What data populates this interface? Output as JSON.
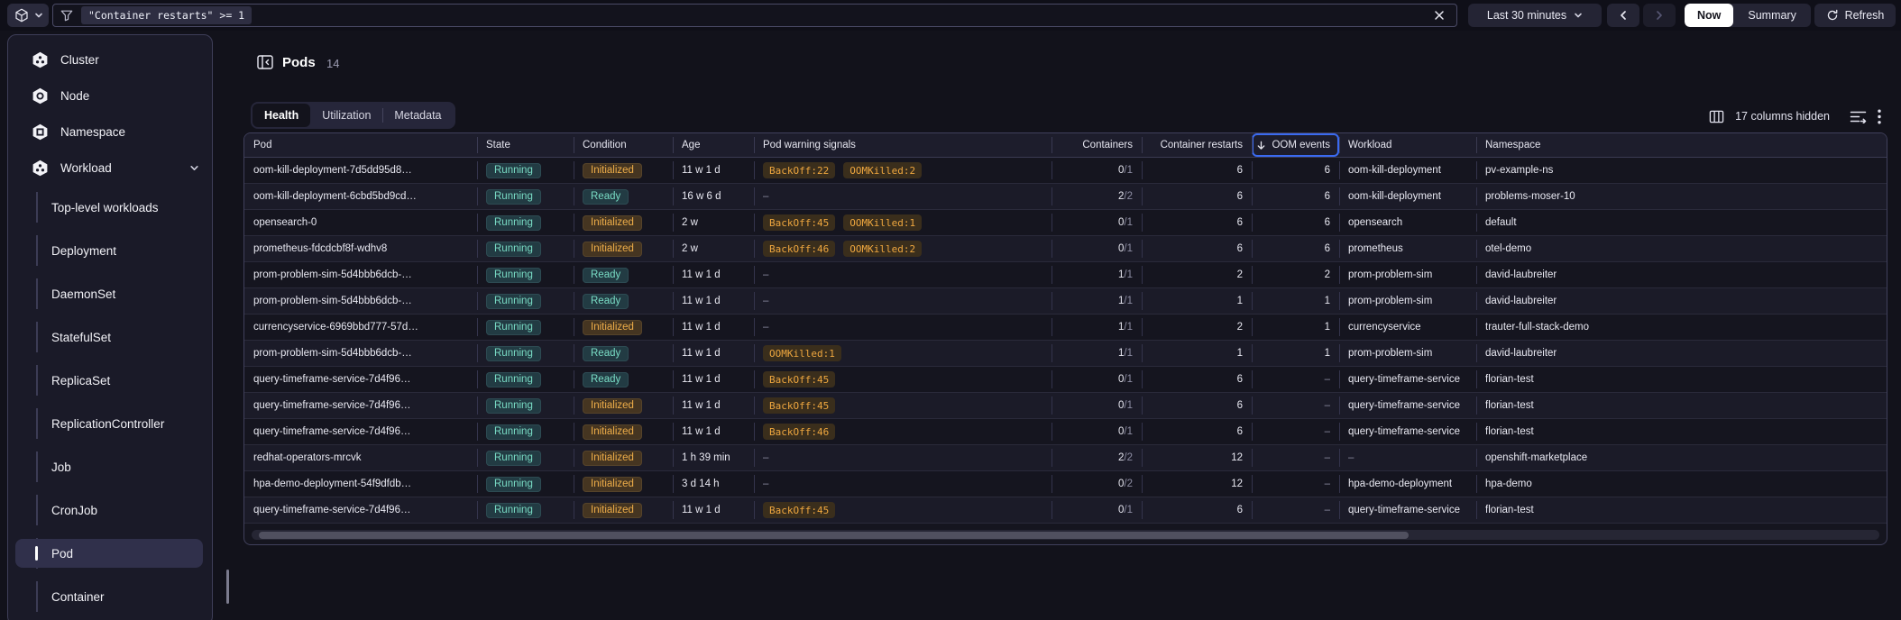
{
  "colors": {
    "accent_blue": "#3a6af0",
    "teal": "#79dcc5",
    "orange": "#efa73f",
    "badge_brown_bg": "#3a2e1c"
  },
  "topbar": {
    "filter_chip": "\"Container restarts\" >= 1",
    "time_range_label": "Last 30 minutes",
    "now_label": "Now",
    "summary_label": "Summary",
    "refresh_label": "Refresh"
  },
  "sidebar": {
    "items": [
      {
        "label": "Cluster",
        "icon": "cluster-icon",
        "level": 0
      },
      {
        "label": "Node",
        "icon": "node-icon",
        "level": 0
      },
      {
        "label": "Namespace",
        "icon": "namespace-icon",
        "level": 0
      },
      {
        "label": "Workload",
        "icon": "workload-icon",
        "level": 0,
        "expanded": true
      },
      {
        "label": "Top-level workloads",
        "level": 1
      },
      {
        "label": "Deployment",
        "level": 1
      },
      {
        "label": "DaemonSet",
        "level": 1
      },
      {
        "label": "StatefulSet",
        "level": 1
      },
      {
        "label": "ReplicaSet",
        "level": 1
      },
      {
        "label": "ReplicationController",
        "level": 1
      },
      {
        "label": "Job",
        "level": 1
      },
      {
        "label": "CronJob",
        "level": 1
      },
      {
        "label": "Pod",
        "level": 1,
        "selected": true
      },
      {
        "label": "Container",
        "level": 1
      }
    ]
  },
  "main": {
    "title": "Pods",
    "count": "14",
    "tabs": [
      {
        "label": "Health",
        "active": true
      },
      {
        "label": "Utilization",
        "active": false
      },
      {
        "label": "Metadata",
        "active": false
      }
    ],
    "columns_hidden": "17 columns hidden"
  },
  "table": {
    "columns": [
      {
        "id": "pod",
        "label": "Pod"
      },
      {
        "id": "state",
        "label": "State"
      },
      {
        "id": "condition",
        "label": "Condition"
      },
      {
        "id": "age",
        "label": "Age"
      },
      {
        "id": "warnings",
        "label": "Pod warning signals"
      },
      {
        "id": "containers",
        "label": "Containers",
        "align": "right"
      },
      {
        "id": "restarts",
        "label": "Container restarts",
        "align": "right"
      },
      {
        "id": "oom",
        "label": "OOM events",
        "align": "right",
        "sorted": "desc",
        "focused": true
      },
      {
        "id": "workload",
        "label": "Workload"
      },
      {
        "id": "namespace",
        "label": "Namespace"
      }
    ],
    "rows": [
      {
        "pod": "oom-kill-deployment-7d5dd95d8…",
        "state": "Running",
        "condition": "Initialized",
        "age": "11 w 1 d",
        "warnings": [
          "BackOff:22",
          "OOMKilled:2"
        ],
        "containers_ready": "0",
        "containers_total": "/1",
        "restarts": "6",
        "oom": "6",
        "workload": "oom-kill-deployment",
        "namespace": "pv-example-ns"
      },
      {
        "pod": "oom-kill-deployment-6cbd5bd9cd…",
        "state": "Running",
        "condition": "Ready",
        "age": "16 w 6 d",
        "warnings": [],
        "containers_ready": "2",
        "containers_total": "/2",
        "restarts": "6",
        "oom": "6",
        "workload": "oom-kill-deployment",
        "namespace": "problems-moser-10"
      },
      {
        "pod": "opensearch-0",
        "state": "Running",
        "condition": "Initialized",
        "age": "2 w",
        "warnings": [
          "BackOff:45",
          "OOMKilled:1"
        ],
        "containers_ready": "0",
        "containers_total": "/1",
        "restarts": "6",
        "oom": "6",
        "workload": "opensearch",
        "namespace": "default"
      },
      {
        "pod": "prometheus-fdcdcbf8f-wdhv8",
        "state": "Running",
        "condition": "Initialized",
        "age": "2 w",
        "warnings": [
          "BackOff:46",
          "OOMKilled:2"
        ],
        "containers_ready": "0",
        "containers_total": "/1",
        "restarts": "6",
        "oom": "6",
        "workload": "prometheus",
        "namespace": "otel-demo"
      },
      {
        "pod": "prom-problem-sim-5d4bbb6dcb-…",
        "state": "Running",
        "condition": "Ready",
        "age": "11 w 1 d",
        "warnings": [],
        "containers_ready": "1",
        "containers_total": "/1",
        "restarts": "2",
        "oom": "2",
        "workload": "prom-problem-sim",
        "namespace": "david-laubreiter"
      },
      {
        "pod": "prom-problem-sim-5d4bbb6dcb-…",
        "state": "Running",
        "condition": "Ready",
        "age": "11 w 1 d",
        "warnings": [],
        "containers_ready": "1",
        "containers_total": "/1",
        "restarts": "1",
        "oom": "1",
        "workload": "prom-problem-sim",
        "namespace": "david-laubreiter"
      },
      {
        "pod": "currencyservice-6969bbd777-57d…",
        "state": "Running",
        "condition": "Initialized",
        "age": "11 w 1 d",
        "warnings": [],
        "containers_ready": "1",
        "containers_total": "/1",
        "restarts": "2",
        "oom": "1",
        "workload": "currencyservice",
        "namespace": "trauter-full-stack-demo"
      },
      {
        "pod": "prom-problem-sim-5d4bbb6dcb-…",
        "state": "Running",
        "condition": "Ready",
        "age": "11 w 1 d",
        "warnings": [
          "OOMKilled:1"
        ],
        "containers_ready": "1",
        "containers_total": "/1",
        "restarts": "1",
        "oom": "1",
        "workload": "prom-problem-sim",
        "namespace": "david-laubreiter"
      },
      {
        "pod": "query-timeframe-service-7d4f96…",
        "state": "Running",
        "condition": "Ready",
        "age": "11 w 1 d",
        "warnings": [
          "BackOff:45"
        ],
        "containers_ready": "0",
        "containers_total": "/1",
        "restarts": "6",
        "oom": "–",
        "workload": "query-timeframe-service",
        "namespace": "florian-test"
      },
      {
        "pod": "query-timeframe-service-7d4f96…",
        "state": "Running",
        "condition": "Initialized",
        "age": "11 w 1 d",
        "warnings": [
          "BackOff:45"
        ],
        "containers_ready": "0",
        "containers_total": "/1",
        "restarts": "6",
        "oom": "–",
        "workload": "query-timeframe-service",
        "namespace": "florian-test"
      },
      {
        "pod": "query-timeframe-service-7d4f96…",
        "state": "Running",
        "condition": "Initialized",
        "age": "11 w 1 d",
        "warnings": [
          "BackOff:46"
        ],
        "containers_ready": "0",
        "containers_total": "/1",
        "restarts": "6",
        "oom": "–",
        "workload": "query-timeframe-service",
        "namespace": "florian-test"
      },
      {
        "pod": "redhat-operators-mrcvk",
        "state": "Running",
        "condition": "Initialized",
        "age": "1 h 39 min",
        "warnings": [],
        "containers_ready": "2",
        "containers_total": "/2",
        "restarts": "12",
        "oom": "–",
        "workload": "–",
        "namespace": "openshift-marketplace"
      },
      {
        "pod": "hpa-demo-deployment-54f9dfdb…",
        "state": "Running",
        "condition": "Initialized",
        "age": "3 d 14 h",
        "warnings": [],
        "containers_ready": "0",
        "containers_total": "/2",
        "restarts": "12",
        "oom": "–",
        "workload": "hpa-demo-deployment",
        "namespace": "hpa-demo"
      },
      {
        "pod": "query-timeframe-service-7d4f96…",
        "state": "Running",
        "condition": "Initialized",
        "age": "11 w 1 d",
        "warnings": [
          "BackOff:45"
        ],
        "containers_ready": "0",
        "containers_total": "/1",
        "restarts": "6",
        "oom": "–",
        "workload": "query-timeframe-service",
        "namespace": "florian-test"
      }
    ]
  }
}
